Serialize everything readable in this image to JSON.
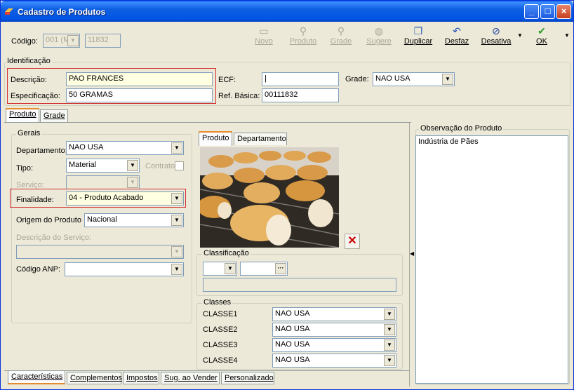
{
  "window": {
    "title": "Cadastro de Produtos"
  },
  "toolbar": {
    "codigo_label": "Código:",
    "codigo_prefix": "001 (M",
    "codigo_value": "11832",
    "novo": "Novo",
    "produto": "Produto",
    "grade": "Grade",
    "sugere": "Sugere",
    "duplicar": "Duplicar",
    "desfaz": "Desfaz",
    "desativa": "Desativa",
    "ok": "OK"
  },
  "identificacao": {
    "title": "Identificação",
    "descricao_label": "Descrição:",
    "descricao_value": "PAO FRANCES",
    "especificacao_label": "Especificação:",
    "especificacao_value": "50 GRAMAS",
    "ecf_label": "ECF:",
    "ecf_value": "|",
    "ref_label": "Ref. Básica:",
    "ref_value": "00111832",
    "grade_label": "Grade:",
    "grade_value": "NAO USA"
  },
  "top_tabs": [
    "Produto",
    "Grade"
  ],
  "gerais": {
    "title": "Gerais",
    "departamento_label": "Departamento:",
    "departamento_value": "NAO USA",
    "tipo_label": "Tipo:",
    "tipo_value": "Material",
    "contrato_label": "Contrato",
    "servico_label": "Serviço:",
    "finalidade_label": "Finalidade:",
    "finalidade_value": "04 - Produto Acabado",
    "origem_label": "Origem do Produto",
    "origem_value": "Nacional",
    "desc_servico_label": "Descrição do Serviço:",
    "codigo_anp_label": "Código ANP:"
  },
  "image_tabs": [
    "Produto",
    "Departamento"
  ],
  "classificacao": {
    "title": "Classificação"
  },
  "classes": {
    "title": "Classes",
    "rows": [
      {
        "label": "CLASSE1",
        "value": "NAO USA"
      },
      {
        "label": "CLASSE2",
        "value": "NAO USA"
      },
      {
        "label": "CLASSE3",
        "value": "NAO USA"
      },
      {
        "label": "CLASSE4",
        "value": "NAO USA"
      }
    ]
  },
  "observacao": {
    "title": "Observação do Produto",
    "text": "Indústria de Pães"
  },
  "bottom_tabs": [
    "Características",
    "Complementos",
    "Impostos",
    "Sug. ao Vender",
    "Personalizado"
  ],
  "colors": {
    "title_bar": "#0054e3",
    "window_bg": "#ece9d8",
    "highlight_border": "#d32f2f",
    "active_tab_accent": "#e68b2c",
    "remove_icon": "#cc0000"
  }
}
